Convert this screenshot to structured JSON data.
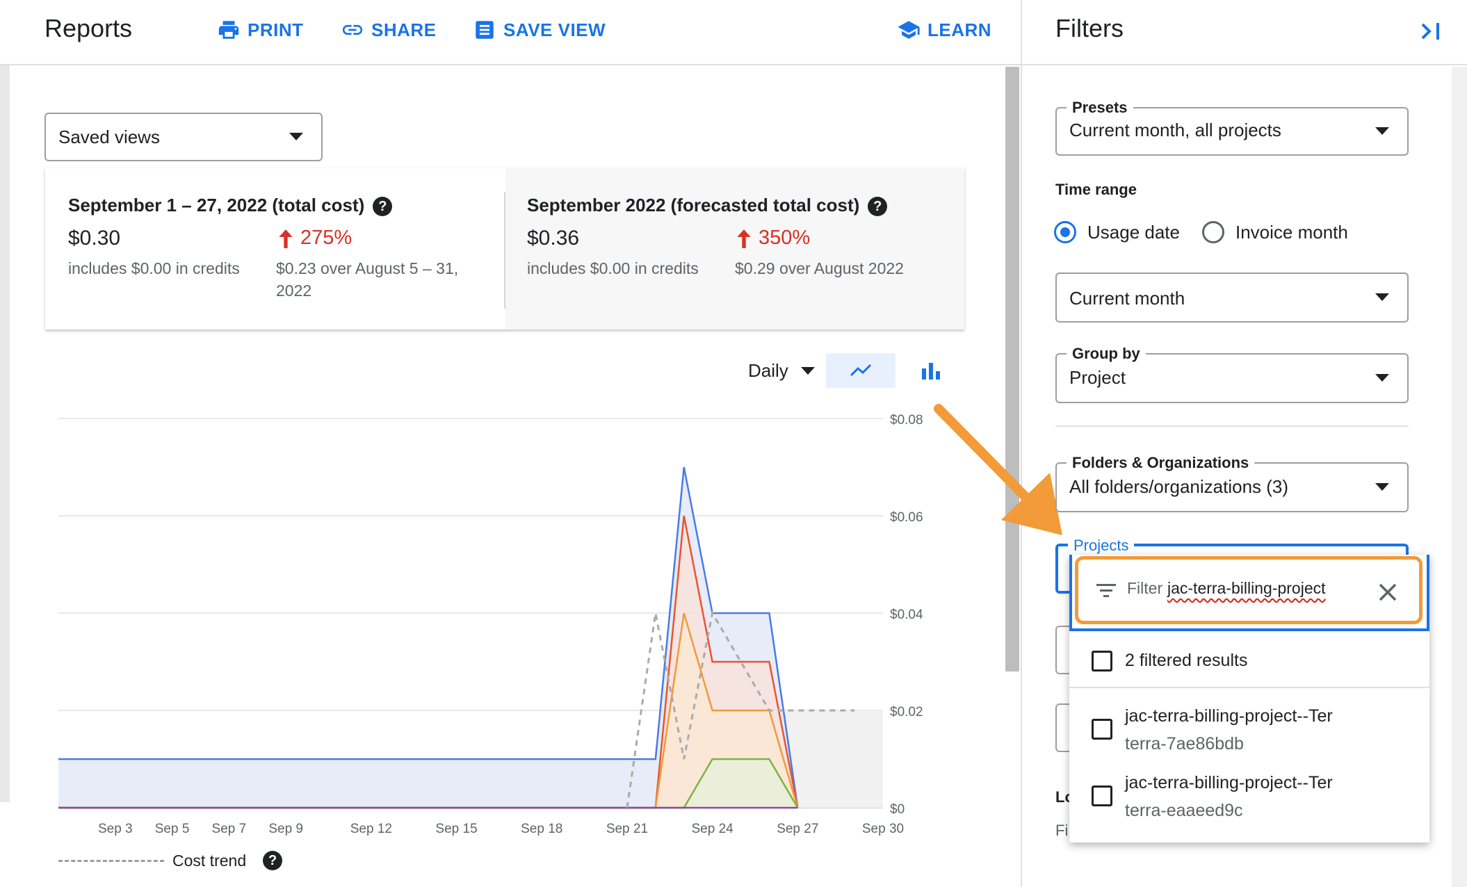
{
  "header": {
    "title": "Reports",
    "print_label": "PRINT",
    "share_label": "SHARE",
    "save_view_label": "SAVE VIEW",
    "learn_label": "LEARN"
  },
  "saved_views": {
    "value": "Saved views"
  },
  "summary": {
    "left": {
      "title": "September 1 – 27, 2022 (total cost)",
      "amount": "$0.30",
      "credits": "includes $0.00 in credits",
      "change": "275%",
      "comparison": "$0.23 over August 5 – 31, 2022"
    },
    "right": {
      "title": "September 2022 (forecasted total cost)",
      "amount": "$0.36",
      "credits": "includes $0.00 in credits",
      "change": "350%",
      "comparison": "$0.29 over August 2022"
    }
  },
  "chart_controls": {
    "granularity": "Daily"
  },
  "chart_data": {
    "type": "area",
    "x": [
      "Sep 1",
      "Sep 2",
      "Sep 3",
      "Sep 4",
      "Sep 5",
      "Sep 6",
      "Sep 7",
      "Sep 8",
      "Sep 9",
      "Sep 10",
      "Sep 11",
      "Sep 12",
      "Sep 13",
      "Sep 14",
      "Sep 15",
      "Sep 16",
      "Sep 17",
      "Sep 18",
      "Sep 19",
      "Sep 20",
      "Sep 21",
      "Sep 22",
      "Sep 23",
      "Sep 24",
      "Sep 25",
      "Sep 26",
      "Sep 27",
      "Sep 28",
      "Sep 29",
      "Sep 30"
    ],
    "tick_labels": [
      "Sep 3",
      "Sep 5",
      "Sep 7",
      "Sep 9",
      "Sep 12",
      "Sep 15",
      "Sep 18",
      "Sep 21",
      "Sep 24",
      "Sep 27",
      "Sep 30"
    ],
    "y_ticks": [
      "$0",
      "$0.02",
      "$0.04",
      "$0.06",
      "$0.08"
    ],
    "ylim": [
      0,
      0.08
    ],
    "series": [
      {
        "color": "#4a79e8",
        "fill": "#dfe5f6",
        "values": [
          0.01,
          0.01,
          0.01,
          0.01,
          0.01,
          0.01,
          0.01,
          0.01,
          0.01,
          0.01,
          0.01,
          0.01,
          0.01,
          0.01,
          0.01,
          0.01,
          0.01,
          0.01,
          0.01,
          0.01,
          0.01,
          0.01,
          0.07,
          0.04,
          0.04,
          0.04,
          0
        ]
      },
      {
        "color": "#e8552f",
        "fill": "#fbe2da",
        "values": [
          0,
          0,
          0,
          0,
          0,
          0,
          0,
          0,
          0,
          0,
          0,
          0,
          0,
          0,
          0,
          0,
          0,
          0,
          0,
          0,
          0,
          0,
          0.06,
          0.03,
          0.03,
          0.03,
          0
        ]
      },
      {
        "color": "#f09a3a",
        "fill": "#fbe8d2",
        "values": [
          0,
          0,
          0,
          0,
          0,
          0,
          0,
          0,
          0,
          0,
          0,
          0,
          0,
          0,
          0,
          0,
          0,
          0,
          0,
          0,
          0,
          0,
          0.04,
          0.02,
          0.02,
          0.02,
          0
        ]
      },
      {
        "color": "#7cb342",
        "fill": "#e6f0d8",
        "values": [
          0,
          0,
          0,
          0,
          0,
          0,
          0,
          0,
          0,
          0,
          0,
          0,
          0,
          0,
          0,
          0,
          0,
          0,
          0,
          0,
          0,
          0,
          0,
          0.01,
          0.01,
          0.01,
          0
        ]
      },
      {
        "color": "#8e44ad",
        "fill": "none",
        "values": [
          0,
          0,
          0,
          0,
          0,
          0,
          0,
          0,
          0,
          0,
          0,
          0,
          0,
          0,
          0,
          0,
          0,
          0,
          0,
          0,
          0,
          0,
          0,
          0,
          0,
          0,
          0
        ]
      }
    ],
    "trend": {
      "color": "#aaaaaa",
      "points": [
        [
          21,
          0
        ],
        [
          22,
          0.04
        ],
        [
          23,
          0.01
        ],
        [
          24,
          0.04
        ],
        [
          25,
          0.03
        ],
        [
          26,
          0.02
        ],
        [
          27,
          0.02
        ],
        [
          28,
          0.02
        ],
        [
          29,
          0.02
        ]
      ]
    },
    "legend": "Cost trend"
  },
  "filters": {
    "title": "Filters",
    "presets": {
      "label": "Presets",
      "value": "Current month, all projects"
    },
    "time_range": {
      "label": "Time range",
      "options": [
        "Usage date",
        "Invoice month"
      ],
      "selected": "Usage date",
      "range_value": "Current month"
    },
    "group_by": {
      "label": "Group by",
      "value": "Project"
    },
    "folders": {
      "label": "Folders & Organizations",
      "value": "All folders/organizations (3)"
    },
    "projects": {
      "label": "Projects",
      "filter_prefix": "Filter",
      "filter_value": "jac-terra-billing-project",
      "select_all_label": "2 filtered results",
      "results": [
        {
          "name": "jac-terra-billing-project--Ter",
          "id": "terra-7ae86bdb"
        },
        {
          "name": "jac-terra-billing-project--Ter",
          "id": "terra-eaaeed9c"
        }
      ]
    },
    "hidden_partial": {
      "label_start": "Lo",
      "value_start": "Fi"
    }
  },
  "colors": {
    "accent": "#1a73e8",
    "increase": "#d93025",
    "highlight": "#f29b38"
  }
}
